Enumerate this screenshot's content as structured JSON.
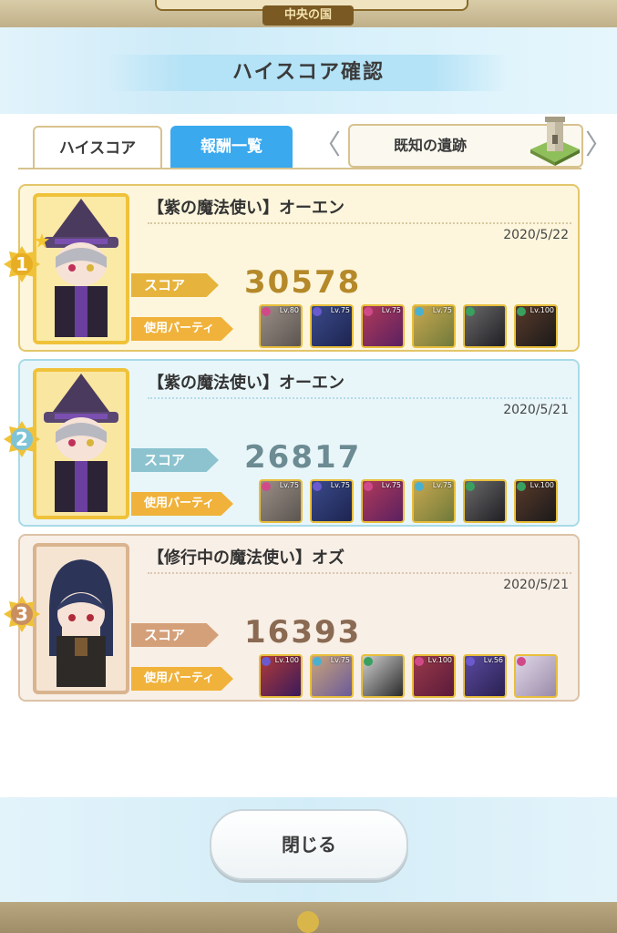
{
  "region": "中央の国",
  "dialog": {
    "title": "ハイスコア確認"
  },
  "tabs": [
    {
      "label": "ハイスコア",
      "active": true
    },
    {
      "label": "報酬一覧",
      "active": false
    }
  ],
  "stage": {
    "name": "既知の遺跡",
    "icon": "tower-ruins-icon"
  },
  "labels": {
    "score": "スコア",
    "party": "使用パーティ"
  },
  "entries": [
    {
      "rank": "1",
      "medal": "gold",
      "name": "【紫の魔法使い】オーエン",
      "date": "2020/5/22",
      "score": "30578",
      "party": [
        {
          "level": "Lv.80"
        },
        {
          "level": "Lv.75"
        },
        {
          "level": "Lv.75"
        },
        {
          "level": "Lv.75"
        },
        {
          "level": ""
        },
        {
          "level": "Lv.100"
        }
      ]
    },
    {
      "rank": "2",
      "medal": "silver",
      "name": "【紫の魔法使い】オーエン",
      "date": "2020/5/21",
      "score": "26817",
      "party": [
        {
          "level": "Lv.75"
        },
        {
          "level": "Lv.75"
        },
        {
          "level": "Lv.75"
        },
        {
          "level": "Lv.75"
        },
        {
          "level": ""
        },
        {
          "level": "Lv.100"
        }
      ]
    },
    {
      "rank": "3",
      "medal": "bronze",
      "name": "【修行中の魔法使い】オズ",
      "date": "2020/5/21",
      "score": "16393",
      "party": [
        {
          "level": "Lv.100"
        },
        {
          "level": "Lv.75"
        },
        {
          "level": ""
        },
        {
          "level": "Lv.100"
        },
        {
          "level": "Lv.56"
        },
        {
          "level": ""
        }
      ]
    }
  ],
  "close_button": "閉じる",
  "colors": {
    "tab_active": "#3aa9ee",
    "gold": "#f0c23a",
    "silver": "#a8dbe8",
    "bronze": "#dcc2a8"
  }
}
